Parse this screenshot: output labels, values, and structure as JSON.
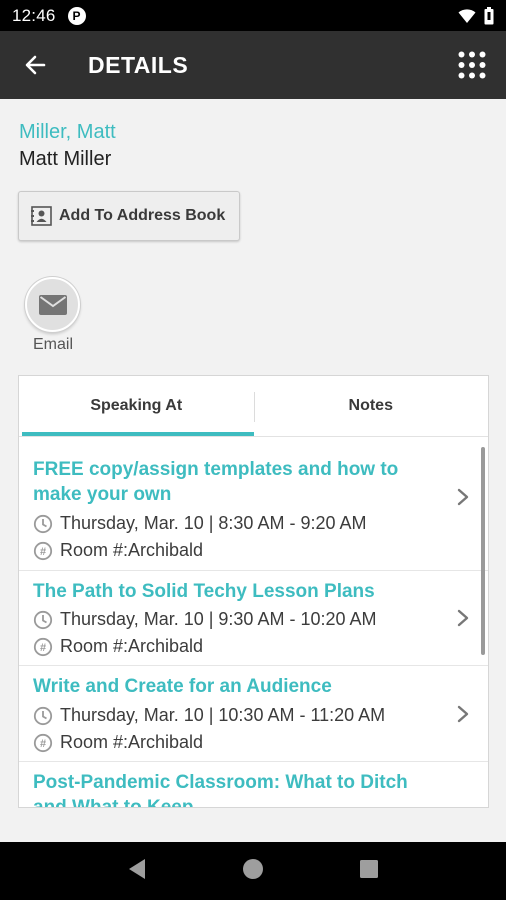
{
  "status": {
    "time": "12:46",
    "app_badge": "P"
  },
  "app_bar": {
    "title": "DETAILS"
  },
  "person": {
    "name": "Miller, Matt",
    "full_name": "Matt Miller"
  },
  "actions": {
    "add_to_address_book": "Add To Address Book",
    "email_label": "Email"
  },
  "tabs": [
    {
      "label": "Speaking At",
      "active": true
    },
    {
      "label": "Notes",
      "active": false
    }
  ],
  "sessions": [
    {
      "title": "FREE copy/assign templates and how to make your own",
      "time": "Thursday, Mar. 10 | 8:30 AM - 9:20 AM",
      "room": "Room #:Archibald"
    },
    {
      "title": "The Path to Solid Techy Lesson Plans",
      "time": "Thursday, Mar. 10 | 9:30 AM - 10:20 AM",
      "room": "Room #:Archibald"
    },
    {
      "title": "Write and Create for an Audience",
      "time": "Thursday, Mar. 10 | 10:30 AM - 11:20 AM",
      "room": "Room #:Archibald"
    },
    {
      "title": "Post-Pandemic Classroom: What to Ditch and What to Keep",
      "time": "",
      "room": ""
    }
  ],
  "colors": {
    "accent": "#3ebcc0",
    "app_bar": "#303030",
    "status_bar": "#000000"
  },
  "icons": [
    "back-arrow-icon",
    "apps-grid-icon",
    "contact-card-icon",
    "mail-icon",
    "clock-icon",
    "room-icon",
    "chevron-right-icon",
    "wifi-icon",
    "battery-icon"
  ]
}
